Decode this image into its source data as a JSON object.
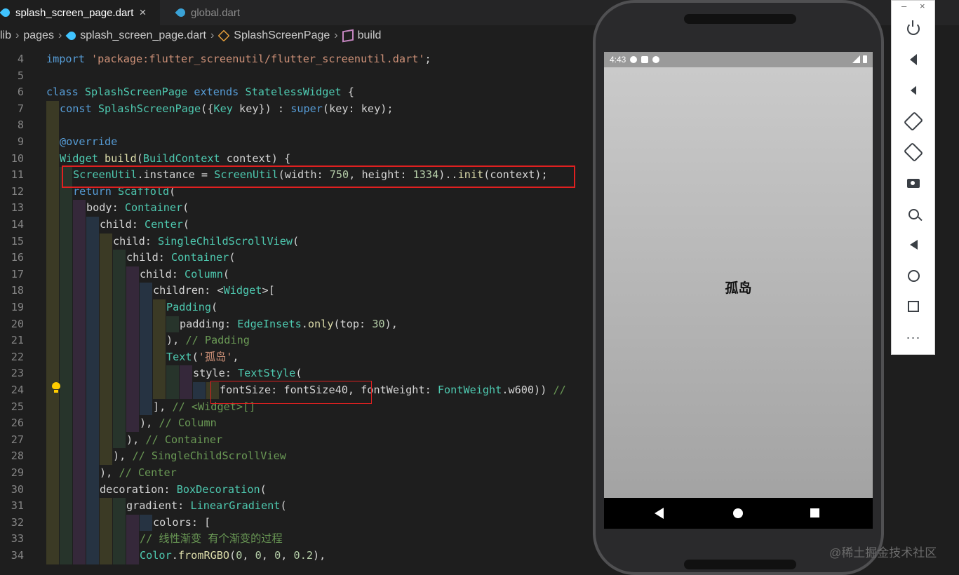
{
  "tabs": [
    {
      "label": "splash_screen_page.dart",
      "close": "×"
    },
    {
      "label": "global.dart"
    }
  ],
  "breadcrumb": [
    "lib",
    "pages",
    "splash_screen_page.dart",
    "SplashScreenPage",
    "build"
  ],
  "breadcrumb_sep": "›",
  "code_lines": [
    {
      "n": "4",
      "guides": 0,
      "tokens": [
        {
          "t": "import",
          "c": "kw"
        },
        {
          "t": " ",
          "c": "plain"
        },
        {
          "t": "'package:flutter_screenutil/flutter_screenutil.dart'",
          "c": "str"
        },
        {
          "t": ";",
          "c": "plain"
        }
      ]
    },
    {
      "n": "5",
      "guides": 0,
      "tokens": []
    },
    {
      "n": "6",
      "guides": 0,
      "tokens": [
        {
          "t": "class",
          "c": "kw"
        },
        {
          "t": " SplashScreenPage ",
          "c": "cls"
        },
        {
          "t": "extends",
          "c": "kw"
        },
        {
          "t": " StatelessWidget",
          "c": "cls"
        },
        {
          "t": " {",
          "c": "plain"
        }
      ]
    },
    {
      "n": "7",
      "guides": 1,
      "tokens": [
        {
          "t": "const",
          "c": "kw"
        },
        {
          "t": " SplashScreenPage",
          "c": "cls"
        },
        {
          "t": "({",
          "c": "plain"
        },
        {
          "t": "Key",
          "c": "cls"
        },
        {
          "t": " key}) : ",
          "c": "plain"
        },
        {
          "t": "super",
          "c": "kw"
        },
        {
          "t": "(key: key);",
          "c": "plain"
        }
      ]
    },
    {
      "n": "8",
      "guides": 1,
      "tokens": []
    },
    {
      "n": "9",
      "guides": 1,
      "tokens": [
        {
          "t": "@override",
          "c": "kw"
        }
      ]
    },
    {
      "n": "10",
      "guides": 1,
      "tokens": [
        {
          "t": "Widget",
          "c": "cls"
        },
        {
          "t": " build",
          "c": "fn"
        },
        {
          "t": "(",
          "c": "plain"
        },
        {
          "t": "BuildContext",
          "c": "cls"
        },
        {
          "t": " context) {",
          "c": "plain"
        }
      ]
    },
    {
      "n": "11",
      "guides": 2,
      "tokens": [
        {
          "t": "ScreenUtil",
          "c": "cls"
        },
        {
          "t": ".instance = ",
          "c": "plain"
        },
        {
          "t": "ScreenUtil",
          "c": "cls"
        },
        {
          "t": "(width: ",
          "c": "plain"
        },
        {
          "t": "750",
          "c": "num"
        },
        {
          "t": ", height: ",
          "c": "plain"
        },
        {
          "t": "1334",
          "c": "num"
        },
        {
          "t": ")..",
          "c": "plain"
        },
        {
          "t": "init",
          "c": "fn"
        },
        {
          "t": "(context);",
          "c": "plain"
        }
      ]
    },
    {
      "n": "12",
      "guides": 2,
      "tokens": [
        {
          "t": "return",
          "c": "kw"
        },
        {
          "t": " Scaffold",
          "c": "cls"
        },
        {
          "t": "(",
          "c": "plain"
        }
      ]
    },
    {
      "n": "13",
      "guides": 3,
      "tokens": [
        {
          "t": "body: ",
          "c": "plain"
        },
        {
          "t": "Container",
          "c": "cls"
        },
        {
          "t": "(",
          "c": "plain"
        }
      ]
    },
    {
      "n": "14",
      "guides": 4,
      "tokens": [
        {
          "t": "child: ",
          "c": "plain"
        },
        {
          "t": "Center",
          "c": "cls"
        },
        {
          "t": "(",
          "c": "plain"
        }
      ]
    },
    {
      "n": "15",
      "guides": 5,
      "tokens": [
        {
          "t": "child: ",
          "c": "plain"
        },
        {
          "t": "SingleChildScrollView",
          "c": "cls"
        },
        {
          "t": "(",
          "c": "plain"
        }
      ]
    },
    {
      "n": "16",
      "guides": 6,
      "tokens": [
        {
          "t": "child: ",
          "c": "plain"
        },
        {
          "t": "Container",
          "c": "cls"
        },
        {
          "t": "(",
          "c": "plain"
        }
      ]
    },
    {
      "n": "17",
      "guides": 7,
      "tokens": [
        {
          "t": "child: ",
          "c": "plain"
        },
        {
          "t": "Column",
          "c": "cls"
        },
        {
          "t": "(",
          "c": "plain"
        }
      ]
    },
    {
      "n": "18",
      "guides": 8,
      "tokens": [
        {
          "t": "children: <",
          "c": "plain"
        },
        {
          "t": "Widget",
          "c": "cls"
        },
        {
          "t": ">[",
          "c": "plain"
        }
      ]
    },
    {
      "n": "19",
      "guides": 9,
      "tokens": [
        {
          "t": "Padding",
          "c": "cls"
        },
        {
          "t": "(",
          "c": "plain"
        }
      ]
    },
    {
      "n": "20",
      "guides": 10,
      "tokens": [
        {
          "t": "padding: ",
          "c": "plain"
        },
        {
          "t": "EdgeInsets",
          "c": "cls"
        },
        {
          "t": ".",
          "c": "plain"
        },
        {
          "t": "only",
          "c": "fn"
        },
        {
          "t": "(top: ",
          "c": "plain"
        },
        {
          "t": "30",
          "c": "num"
        },
        {
          "t": "),",
          "c": "plain"
        }
      ]
    },
    {
      "n": "21",
      "guides": 9,
      "tokens": [
        {
          "t": "), ",
          "c": "plain"
        },
        {
          "t": "// Padding",
          "c": "cmt"
        }
      ]
    },
    {
      "n": "22",
      "guides": 9,
      "tokens": [
        {
          "t": "Text",
          "c": "cls"
        },
        {
          "t": "(",
          "c": "plain"
        },
        {
          "t": "'孤岛'",
          "c": "str"
        },
        {
          "t": ",",
          "c": "plain"
        }
      ]
    },
    {
      "n": "23",
      "guides": 11,
      "tokens": [
        {
          "t": "style: ",
          "c": "plain"
        },
        {
          "t": "TextStyle",
          "c": "cls"
        },
        {
          "t": "(",
          "c": "plain"
        }
      ]
    },
    {
      "n": "24",
      "guides": 13,
      "tokens": [
        {
          "t": "fontSize: fontSize40, fontWeight: ",
          "c": "plain"
        },
        {
          "t": "FontWeight",
          "c": "cls"
        },
        {
          "t": ".w600)) ",
          "c": "plain"
        },
        {
          "t": "//",
          "c": "cmt"
        }
      ]
    },
    {
      "n": "25",
      "guides": 8,
      "tokens": [
        {
          "t": "], ",
          "c": "plain"
        },
        {
          "t": "// <Widget>[]",
          "c": "cmt"
        }
      ]
    },
    {
      "n": "26",
      "guides": 7,
      "tokens": [
        {
          "t": "), ",
          "c": "plain"
        },
        {
          "t": "// Column",
          "c": "cmt"
        }
      ]
    },
    {
      "n": "27",
      "guides": 6,
      "tokens": [
        {
          "t": "), ",
          "c": "plain"
        },
        {
          "t": "// Container",
          "c": "cmt"
        }
      ]
    },
    {
      "n": "28",
      "guides": 5,
      "tokens": [
        {
          "t": "), ",
          "c": "plain"
        },
        {
          "t": "// SingleChildScrollView",
          "c": "cmt"
        }
      ]
    },
    {
      "n": "29",
      "guides": 4,
      "tokens": [
        {
          "t": "), ",
          "c": "plain"
        },
        {
          "t": "// Center",
          "c": "cmt"
        }
      ]
    },
    {
      "n": "30",
      "guides": 4,
      "tokens": [
        {
          "t": "decoration: ",
          "c": "plain"
        },
        {
          "t": "BoxDecoration",
          "c": "cls"
        },
        {
          "t": "(",
          "c": "plain"
        }
      ]
    },
    {
      "n": "31",
      "guides": 6,
      "tokens": [
        {
          "t": "gradient: ",
          "c": "plain"
        },
        {
          "t": "LinearGradient",
          "c": "cls"
        },
        {
          "t": "(",
          "c": "plain"
        }
      ]
    },
    {
      "n": "32",
      "guides": 8,
      "tokens": [
        {
          "t": "colors: [",
          "c": "plain"
        }
      ]
    },
    {
      "n": "33",
      "guides": 7,
      "tokens": [
        {
          "t": "// 线性渐变 有个渐变的过程",
          "c": "cmt"
        }
      ]
    },
    {
      "n": "34",
      "guides": 7,
      "tokens": [
        {
          "t": "Color",
          "c": "cls"
        },
        {
          "t": ".",
          "c": "plain"
        },
        {
          "t": "fromRGBO",
          "c": "fn"
        },
        {
          "t": "(",
          "c": "plain"
        },
        {
          "t": "0",
          "c": "num"
        },
        {
          "t": ", ",
          "c": "plain"
        },
        {
          "t": "0",
          "c": "num"
        },
        {
          "t": ", ",
          "c": "plain"
        },
        {
          "t": "0",
          "c": "num"
        },
        {
          "t": ", ",
          "c": "plain"
        },
        {
          "t": "0.2",
          "c": "num"
        },
        {
          "t": "),",
          "c": "plain"
        }
      ]
    }
  ],
  "phone": {
    "status_time": "4:43",
    "app_text": "孤岛"
  },
  "emulator_panel": {
    "minimize": "–",
    "close": "×",
    "buttons": [
      "power-icon",
      "volume-up-icon",
      "volume-down-icon",
      "rotate-left-icon",
      "rotate-right-icon",
      "camera-icon",
      "zoom-icon",
      "back-icon",
      "home-icon",
      "overview-icon",
      "more-icon"
    ],
    "more_glyph": "···"
  },
  "watermark": "@稀土掘金技术社区",
  "colors": {
    "editor_bg": "#1e1e1e",
    "highlight_box": "#e02020",
    "guide_colors": [
      "#3b3a25",
      "#27342b",
      "#35283a",
      "#263342",
      "#3b3a25",
      "#27342b",
      "#35283a",
      "#263342",
      "#3b3a25",
      "#27342b",
      "#35283a",
      "#263342",
      "#3b3a25"
    ]
  }
}
